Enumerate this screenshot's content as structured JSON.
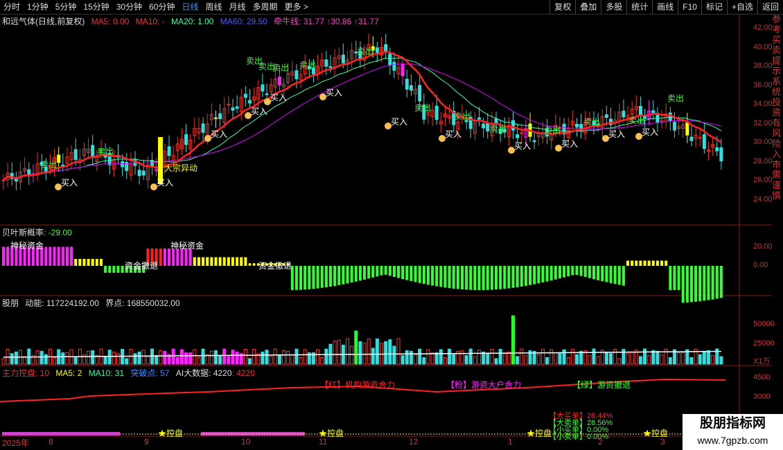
{
  "periods": [
    {
      "label": "分时",
      "active": false
    },
    {
      "label": "1分钟",
      "active": false
    },
    {
      "label": "5分钟",
      "active": false
    },
    {
      "label": "15分钟",
      "active": false
    },
    {
      "label": "30分钟",
      "active": false
    },
    {
      "label": "60分钟",
      "active": false
    },
    {
      "label": "日线",
      "active": true
    },
    {
      "label": "周线",
      "active": false
    },
    {
      "label": "月线",
      "active": false
    },
    {
      "label": "多周期",
      "active": false
    },
    {
      "label": "更多 >",
      "active": false
    }
  ],
  "tools": [
    "复权",
    "叠加",
    "多股",
    "统计",
    "画线",
    "F10",
    "标记",
    "+自选",
    "返回"
  ],
  "main": {
    "title": "和远气体(日线,前复权)",
    "ma5": "MA5: 0.00",
    "ma10": "MA10: -",
    "ma20": "MA20: 1.00",
    "ma60": "MA60: 29.50",
    "qianniu": "牵牛线: 31.77 ↑30.86 ↑31.77",
    "axis": [
      "42.00",
      "40.00",
      "38.00",
      "36.00",
      "34.00",
      "32.00",
      "30.00",
      "28.00",
      "26.00",
      "24.00"
    ],
    "sell_label": "卖出",
    "buy_label": "买入",
    "block_label": "大宗异动"
  },
  "bayes": {
    "title": "贝叶斯概率",
    "value": ": -29.00",
    "axis": [
      "20.00",
      "0.00"
    ],
    "ann1": "神秘资金",
    "ann2": "神秘资金",
    "ann3": "资金撤退",
    "ann4": "资金撤退"
  },
  "volume": {
    "title": "股朋",
    "dongneng": "动能: 117224192.00",
    "jiedian": "界点: 168550032.00",
    "axis": [
      "50000",
      "25000"
    ],
    "unit": "X1万"
  },
  "control": {
    "title": "主力控盘: 10",
    "ma5": "MA5: 2",
    "ma10": "MA10: 31",
    "tupo": "突破点: 57",
    "ai": "AI大数据: 4220",
    "ai2": ": 4220",
    "axis": [
      "4500",
      "3000"
    ],
    "tag1": "【红】机构游资合力",
    "tag2": "【粉】游资大户合力",
    "tag3": "【绿】游资撤退",
    "big_buy": "【大买单】28.44%",
    "big_sell": "【大卖单】28.56%",
    "small_buy": "【小买单】0.00%",
    "small_sell": "【小卖单】0.00%",
    "kongpan": "控盘"
  },
  "dates": [
    "2025年",
    "8",
    "9",
    "10",
    "11",
    "12",
    "1",
    "2",
    "3"
  ],
  "watermark": {
    "line1": "股朋指标网",
    "line2": "www.7gpzb.com"
  },
  "side_text": "参考买卖提示系统投资有风险入市需谨慎"
}
